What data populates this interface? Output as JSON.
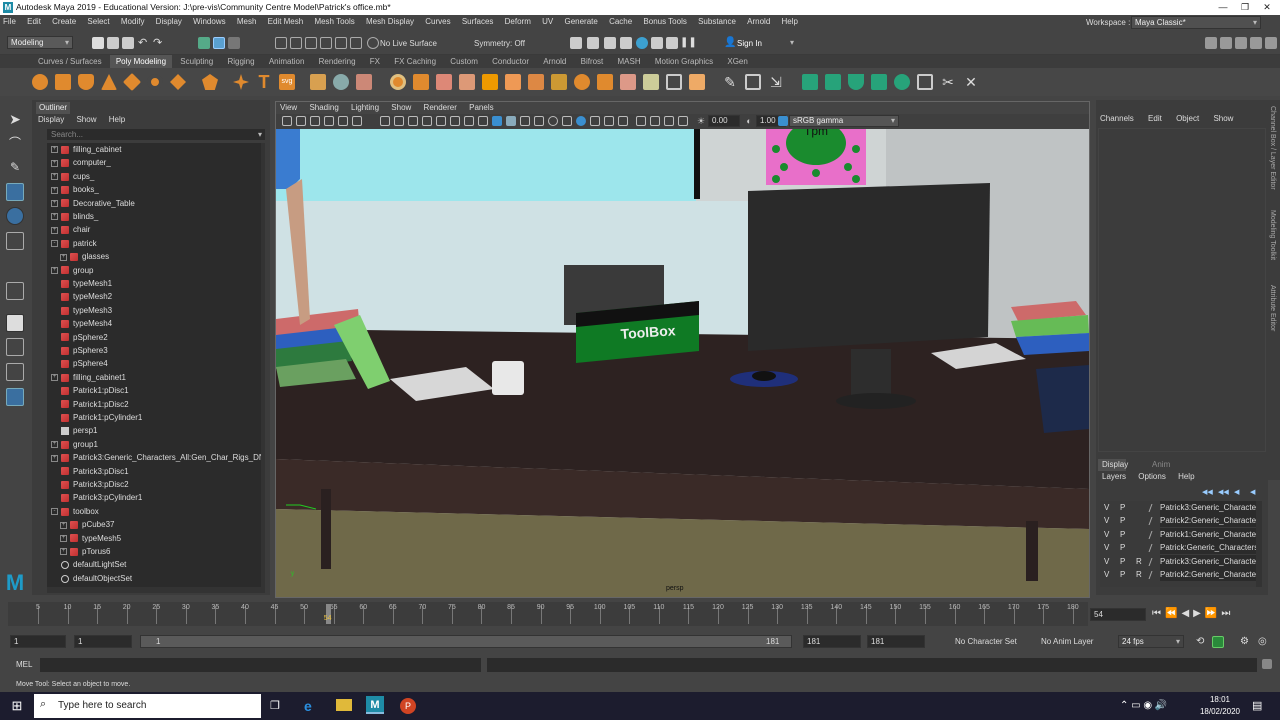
{
  "window": {
    "title": "Autodesk Maya 2019 - Educational Version: J:\\pre-vis\\Community Centre Model\\Patrick's office.mb*",
    "app_logo": "M",
    "controls": [
      "—",
      "❐",
      "✕"
    ]
  },
  "menubar": {
    "items": [
      "File",
      "Edit",
      "Create",
      "Select",
      "Modify",
      "Display",
      "Windows",
      "Mesh",
      "Edit Mesh",
      "Mesh Tools",
      "Mesh Display",
      "Curves",
      "Surfaces",
      "Deform",
      "UV",
      "Generate",
      "Cache",
      "Bonus Tools",
      "Substance",
      "Arnold",
      "Help"
    ],
    "workspace_label": "Workspace :",
    "workspace_value": "Maya Classic*"
  },
  "status_line": {
    "mode": "Modeling",
    "live_surface": "No Live Surface",
    "symmetry": "Symmetry: Off",
    "sign_in": "Sign In"
  },
  "shelf": {
    "tabs": [
      "Curves / Surfaces",
      "Poly Modeling",
      "Sculpting",
      "Rigging",
      "Animation",
      "Rendering",
      "FX",
      "FX Caching",
      "Custom",
      "Conductor",
      "Arnold",
      "Bifrost",
      "MASH",
      "Motion Graphics",
      "XGen"
    ],
    "active_tab": "Poly Modeling"
  },
  "outliner": {
    "tab": "Outliner",
    "menu": [
      "Display",
      "Show",
      "Help"
    ],
    "search_placeholder": "Search...",
    "items": [
      {
        "label": "filling_cabinet",
        "indent": 0,
        "exp": "+",
        "icon": "mesh"
      },
      {
        "label": "computer_",
        "indent": 0,
        "exp": "+",
        "icon": "mesh"
      },
      {
        "label": "cups_",
        "indent": 0,
        "exp": "+",
        "icon": "mesh"
      },
      {
        "label": "books_",
        "indent": 0,
        "exp": "+",
        "icon": "mesh"
      },
      {
        "label": "Decorative_Table",
        "indent": 0,
        "exp": "+",
        "icon": "mesh"
      },
      {
        "label": "blinds_",
        "indent": 0,
        "exp": "+",
        "icon": "mesh"
      },
      {
        "label": "chair",
        "indent": 0,
        "exp": "+",
        "icon": "mesh"
      },
      {
        "label": "patrick",
        "indent": 0,
        "exp": "-",
        "icon": "mesh"
      },
      {
        "label": "glasses",
        "indent": 1,
        "exp": "+",
        "icon": "mesh"
      },
      {
        "label": "group",
        "indent": 0,
        "exp": "+",
        "icon": "mesh"
      },
      {
        "label": "typeMesh1",
        "indent": 0,
        "exp": "",
        "icon": "mesh"
      },
      {
        "label": "typeMesh2",
        "indent": 0,
        "exp": "",
        "icon": "mesh"
      },
      {
        "label": "typeMesh3",
        "indent": 0,
        "exp": "",
        "icon": "mesh"
      },
      {
        "label": "typeMesh4",
        "indent": 0,
        "exp": "",
        "icon": "mesh"
      },
      {
        "label": "pSphere2",
        "indent": 0,
        "exp": "",
        "icon": "mesh"
      },
      {
        "label": "pSphere3",
        "indent": 0,
        "exp": "",
        "icon": "mesh"
      },
      {
        "label": "pSphere4",
        "indent": 0,
        "exp": "",
        "icon": "mesh"
      },
      {
        "label": "filling_cabinet1",
        "indent": 0,
        "exp": "+",
        "icon": "mesh"
      },
      {
        "label": "Patrick1:pDisc1",
        "indent": 0,
        "exp": "",
        "icon": "mesh"
      },
      {
        "label": "Patrick1:pDisc2",
        "indent": 0,
        "exp": "",
        "icon": "mesh"
      },
      {
        "label": "Patrick1:pCylinder1",
        "indent": 0,
        "exp": "",
        "icon": "mesh"
      },
      {
        "label": "persp1",
        "indent": 0,
        "exp": "",
        "icon": "camera"
      },
      {
        "label": "group1",
        "indent": 0,
        "exp": "+",
        "icon": "mesh"
      },
      {
        "label": "Patrick3:Generic_Characters_All:Gen_Char_Rigs_DNT",
        "indent": 0,
        "exp": "+",
        "icon": "mesh"
      },
      {
        "label": "Patrick3:pDisc1",
        "indent": 0,
        "exp": "",
        "icon": "mesh"
      },
      {
        "label": "Patrick3:pDisc2",
        "indent": 0,
        "exp": "",
        "icon": "mesh"
      },
      {
        "label": "Patrick3:pCylinder1",
        "indent": 0,
        "exp": "",
        "icon": "mesh"
      },
      {
        "label": "toolbox",
        "indent": 0,
        "exp": "-",
        "icon": "mesh"
      },
      {
        "label": "pCube37",
        "indent": 1,
        "exp": "+",
        "icon": "mesh"
      },
      {
        "label": "typeMesh5",
        "indent": 1,
        "exp": "+",
        "icon": "mesh"
      },
      {
        "label": "pTorus6",
        "indent": 1,
        "exp": "+",
        "icon": "mesh"
      },
      {
        "label": "defaultLightSet",
        "indent": 0,
        "exp": "",
        "icon": "set"
      },
      {
        "label": "defaultObjectSet",
        "indent": 0,
        "exp": "",
        "icon": "set"
      }
    ]
  },
  "viewport": {
    "menu": [
      "View",
      "Shading",
      "Lighting",
      "Show",
      "Renderer",
      "Panels"
    ],
    "exposure": "0.00",
    "gamma": "1.00",
    "color_space": "sRGB gamma",
    "camera_label": "persp",
    "scene_toolbox_text": "ToolBox",
    "poster_text": "Tpm"
  },
  "channel_box": {
    "menu": [
      "Channels",
      "Edit",
      "Object",
      "Show"
    ],
    "side_tabs": [
      "Channel Box / Layer Editor",
      "Modeling Toolkit",
      "Attribute Editor"
    ]
  },
  "layer_editor": {
    "tabs": [
      "Display",
      "Anim"
    ],
    "active_tab": "Display",
    "menu": [
      "Layers",
      "Options",
      "Help"
    ],
    "layers": [
      {
        "v": "V",
        "p": "P",
        "r": "",
        "name": "Patrick3:Generic_Characters_"
      },
      {
        "v": "V",
        "p": "P",
        "r": "",
        "name": "Patrick2:Generic_Characters_"
      },
      {
        "v": "V",
        "p": "P",
        "r": "",
        "name": "Patrick1:Generic_Characters_"
      },
      {
        "v": "V",
        "p": "P",
        "r": "",
        "name": "Patrick:Generic_Characters_A"
      },
      {
        "v": "V",
        "p": "P",
        "r": "R",
        "name": "Patrick3:Generic_Characters_"
      },
      {
        "v": "V",
        "p": "P",
        "r": "R",
        "name": "Patrick2:Generic_Characters_"
      }
    ]
  },
  "timeline": {
    "ticks": [
      "5",
      "10",
      "15",
      "20",
      "25",
      "30",
      "35",
      "40",
      "45",
      "50",
      "55",
      "60",
      "65",
      "70",
      "75",
      "80",
      "85",
      "90",
      "95",
      "100",
      "105",
      "110",
      "115",
      "120",
      "125",
      "130",
      "135",
      "140",
      "145",
      "150",
      "155",
      "160",
      "165",
      "170",
      "175",
      "180"
    ],
    "current_frame": "54",
    "current_frame_field": "54"
  },
  "range": {
    "start": "1",
    "start2": "1",
    "slider_start": "1",
    "slider_end": "181",
    "end": "181",
    "end2": "181",
    "character_set": "No Character Set",
    "anim_layer": "No Anim Layer",
    "fps": "24 fps"
  },
  "command_line": {
    "label": "MEL"
  },
  "help_line": {
    "text": "Move Tool: Select an object to move."
  },
  "taskbar": {
    "search_placeholder": "Type here to search",
    "time": "18:01",
    "date": "18/02/2020"
  }
}
